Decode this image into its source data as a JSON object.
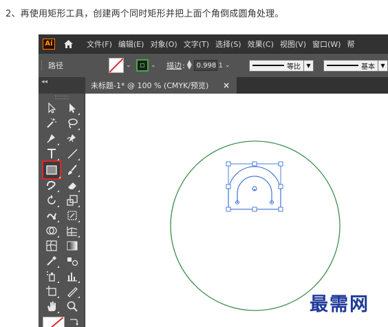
{
  "caption": "2、再使用矩形工具，创建两个同时矩形并把上面个角倒成圆角处理。",
  "app": {
    "logo_text": "Ai",
    "menu": [
      "文件(F)",
      "编辑(E)",
      "对象(O)",
      "文字(T)",
      "选择(S)",
      "效果(C)",
      "视图(V)",
      "窗口(W)",
      "帮"
    ]
  },
  "control_bar": {
    "object_type": "路径",
    "stroke_label": "描边",
    "stroke_weight": "0.998",
    "stroke_unit": "1",
    "profile_1": "等比",
    "profile_2": "基本",
    "fill_color": "#ffffff",
    "stroke_color": "#49a844"
  },
  "document": {
    "tab_title": "未标题-1* @ 100 % (CMYK/预览)",
    "close_glyph": "×",
    "panel_collapse_glyph": "◂◂"
  },
  "tools": [
    {
      "name": "selection-tool-icon",
      "active": false
    },
    {
      "name": "direct-selection-tool-icon",
      "active": false
    },
    {
      "name": "magic-wand-tool-icon",
      "active": false
    },
    {
      "name": "lasso-tool-icon",
      "active": false
    },
    {
      "name": "pen-tool-icon",
      "active": false
    },
    {
      "name": "curvature-tool-icon",
      "active": false
    },
    {
      "name": "type-tool-icon",
      "active": false
    },
    {
      "name": "line-segment-tool-icon",
      "active": false
    },
    {
      "name": "rectangle-tool-icon",
      "active": true
    },
    {
      "name": "paintbrush-tool-icon",
      "active": false
    },
    {
      "name": "shaper-tool-icon",
      "active": false
    },
    {
      "name": "eraser-tool-icon",
      "active": false
    },
    {
      "name": "rotate-tool-icon",
      "active": false
    },
    {
      "name": "scale-tool-icon",
      "active": false
    },
    {
      "name": "warp-tool-icon",
      "active": false
    },
    {
      "name": "free-transform-tool-icon",
      "active": false
    },
    {
      "name": "shape-builder-tool-icon",
      "active": false
    },
    {
      "name": "perspective-grid-tool-icon",
      "active": false
    },
    {
      "name": "mesh-tool-icon",
      "active": false
    },
    {
      "name": "gradient-tool-icon",
      "active": false
    },
    {
      "name": "eyedropper-tool-icon",
      "active": false
    },
    {
      "name": "blend-tool-icon",
      "active": false
    },
    {
      "name": "symbol-sprayer-tool-icon",
      "active": false
    },
    {
      "name": "column-graph-tool-icon",
      "active": false
    },
    {
      "name": "artboard-tool-icon",
      "active": false
    },
    {
      "name": "slice-tool-icon",
      "active": false
    },
    {
      "name": "hand-tool-icon",
      "active": false
    },
    {
      "name": "zoom-tool-icon",
      "active": false
    }
  ],
  "colors": {
    "circle_stroke": "#3f8f4f",
    "selection_blue": "#4a7fd9",
    "highlight_red": "#e0262a"
  },
  "watermark": "最需网"
}
